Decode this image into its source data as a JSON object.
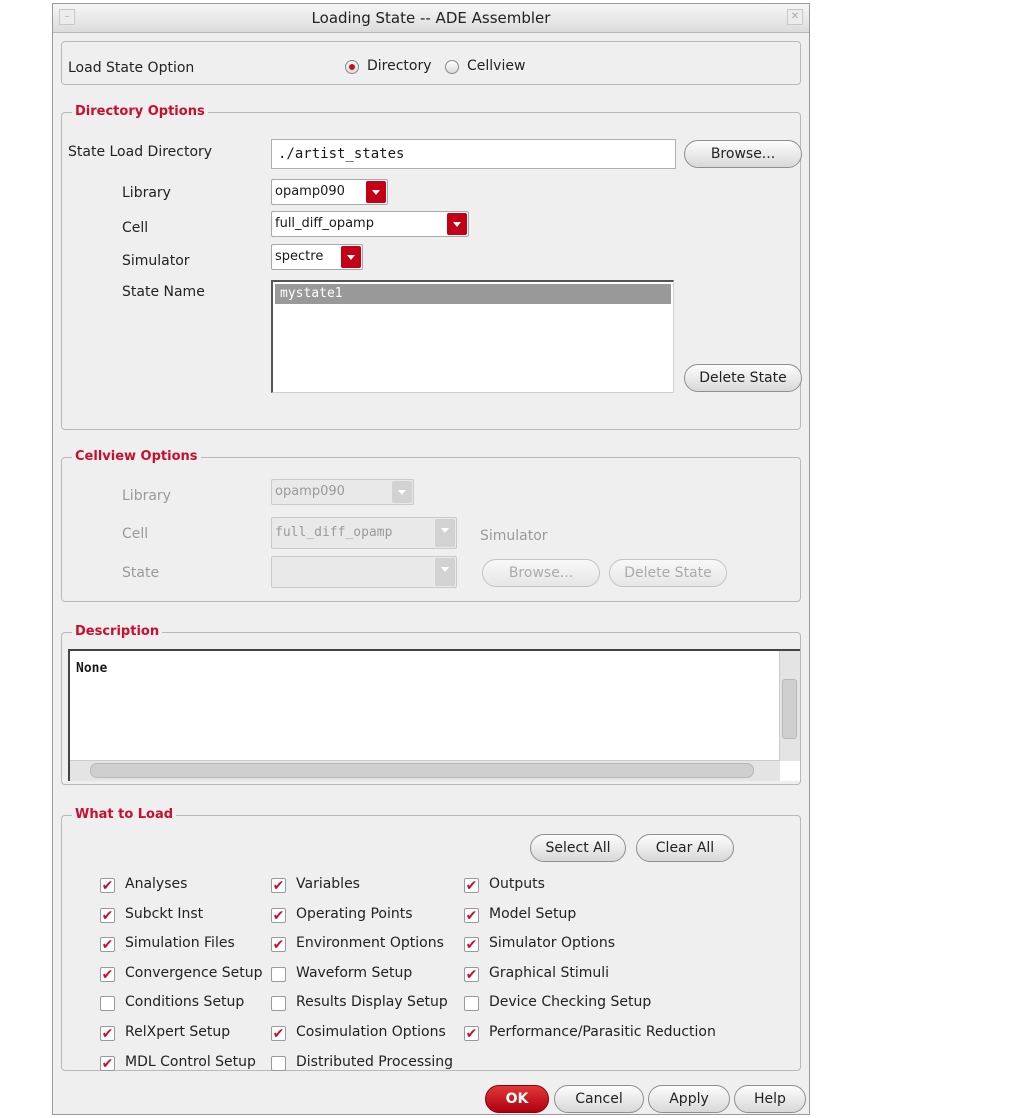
{
  "window": {
    "title": "Loading State -- ADE Assembler"
  },
  "load_state_option": {
    "label": "Load State Option",
    "options": [
      {
        "label": "Directory",
        "selected": true
      },
      {
        "label": "Cellview",
        "selected": false
      }
    ]
  },
  "directory_options": {
    "title": "Directory Options",
    "state_load_directory_label": "State Load Directory",
    "state_load_directory_value": "./artist_states",
    "browse": "Browse...",
    "library_label": "Library",
    "library_value": "opamp090",
    "cell_label": "Cell",
    "cell_value": "full_diff_opamp",
    "simulator_label": "Simulator",
    "simulator_value": "spectre",
    "state_name_label": "State Name",
    "states": [
      "mystate1"
    ],
    "delete_state": "Delete State"
  },
  "cellview_options": {
    "title": "Cellview Options",
    "library_label": "Library",
    "library_value": "opamp090",
    "cell_label": "Cell",
    "cell_value": "full_diff_opamp",
    "simulator_label": "Simulator",
    "state_label": "State",
    "browse": "Browse...",
    "delete_state": "Delete State"
  },
  "description": {
    "title": "Description",
    "text": "None"
  },
  "what_to_load": {
    "title": "What to Load",
    "select_all": "Select All",
    "clear_all": "Clear All",
    "items": [
      {
        "label": "Analyses",
        "checked": true
      },
      {
        "label": "Variables",
        "checked": true
      },
      {
        "label": "Outputs",
        "checked": true
      },
      {
        "label": "Subckt Inst",
        "checked": true
      },
      {
        "label": "Operating Points",
        "checked": true
      },
      {
        "label": "Model Setup",
        "checked": true
      },
      {
        "label": "Simulation Files",
        "checked": true
      },
      {
        "label": "Environment Options",
        "checked": true
      },
      {
        "label": "Simulator Options",
        "checked": true
      },
      {
        "label": "Convergence Setup",
        "checked": true
      },
      {
        "label": "Waveform Setup",
        "checked": false
      },
      {
        "label": "Graphical Stimuli",
        "checked": true
      },
      {
        "label": "Conditions Setup",
        "checked": false
      },
      {
        "label": "Results Display Setup",
        "checked": false
      },
      {
        "label": "Device Checking Setup",
        "checked": false
      },
      {
        "label": "RelXpert Setup",
        "checked": true
      },
      {
        "label": "Cosimulation Options",
        "checked": true
      },
      {
        "label": "Performance/Parasitic Reduction",
        "checked": true
      },
      {
        "label": "MDL Control Setup",
        "checked": true
      },
      {
        "label": "Distributed Processing",
        "checked": false
      }
    ]
  },
  "footer": {
    "ok": "OK",
    "cancel": "Cancel",
    "apply": "Apply",
    "help": "Help"
  },
  "colors": {
    "accent": "#c8102e",
    "background": "#efefef"
  }
}
